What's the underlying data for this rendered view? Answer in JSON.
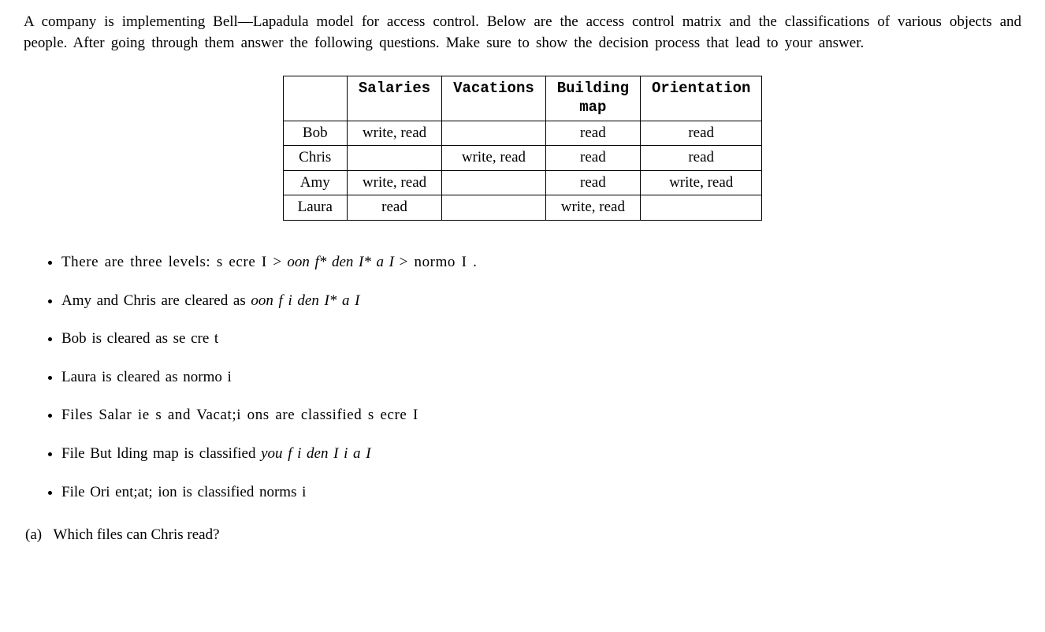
{
  "intro": {
    "line1": "A company is implementing Bell—Lapadula model  for  access  control.  Below  are  the  access  control  matrix",
    "line2": "and the classifications of various objects and people. After going through them answer the following questions.",
    "line3": "Make sure to show the decision process that lead to your answer."
  },
  "table": {
    "headers": {
      "c1": "Salaries",
      "c2": "Vacations",
      "c3a": "Building",
      "c3b": "map",
      "c4": "Orientation"
    },
    "rows": {
      "r1": {
        "name": "Bob",
        "salaries": "write, read",
        "vacations": "",
        "building": "read",
        "orientation": "read"
      },
      "r2": {
        "name": "Chris",
        "salaries": "",
        "vacations": "write, read",
        "building": "read",
        "orientation": "read"
      },
      "r3": {
        "name": "Amy",
        "salaries": "write, read",
        "vacations": "",
        "building": "read",
        "orientation": "write, read"
      },
      "r4": {
        "name": "Laura",
        "salaries": "read",
        "vacations": "",
        "building": "write, read",
        "orientation": ""
      }
    }
  },
  "rules": {
    "b1a": "There are three levels:  s ecre I  >",
    "b1b": " oon f* den I* a I ",
    "b1c": ">    normo I .",
    "b2a": "Amy and Chris are cleared as ",
    "b2b": "oon f i den I* a I",
    "b3": "Bob is cleared as se cre t",
    "b4": "Laura is cleared as normo i",
    "b5": "Files Salar ie s and Vacat;i ons are classified  s ecre I",
    "b6a": "File But lding map is classified ",
    "b6b": "you f i den I i a I",
    "b7": "File Ori ent;at; ion is classified norms i"
  },
  "question": {
    "label": "(a)",
    "text": "Which files can Chris read?"
  }
}
